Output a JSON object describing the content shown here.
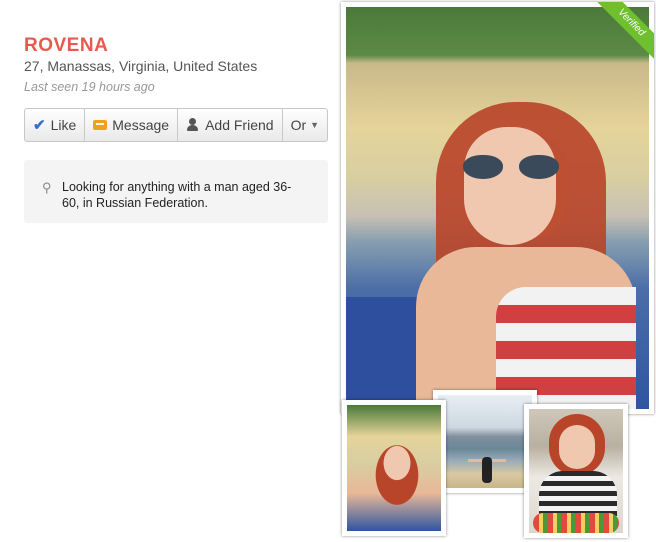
{
  "profile": {
    "name": "ROVENA",
    "location": "27, Manassas, Virginia, United States",
    "last_seen": "Last seen 19 hours ago"
  },
  "actions": {
    "like": "Like",
    "message": "Message",
    "add_friend": "Add Friend",
    "or": "Or"
  },
  "looking_for": "Looking for anything with a man aged 36-60, in Russian Federation.",
  "photos": {
    "verified_badge": "Verified"
  },
  "colors": {
    "name": "#e65a50",
    "verified": "#6fbf2e",
    "like_icon": "#3b6fcf",
    "message_icon": "#f0a020"
  },
  "icons": [
    "checkmark-icon",
    "envelope-icon",
    "add-friend-icon",
    "chevron-down-icon",
    "search-icon"
  ]
}
